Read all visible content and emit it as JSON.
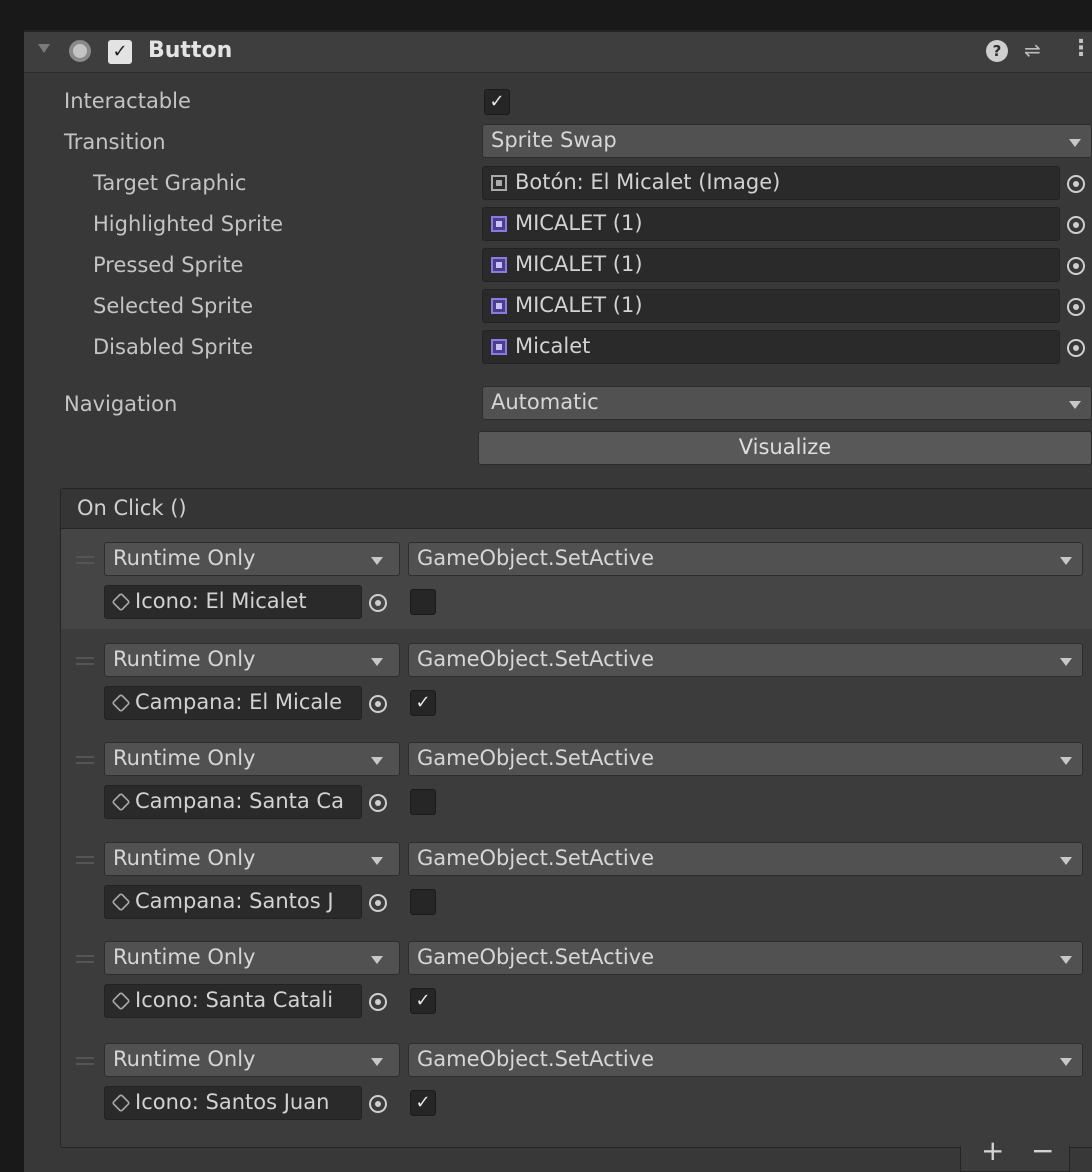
{
  "component": {
    "title": "Button",
    "enabled_check": "✓",
    "fold_icon": "foldout-arrow-icon",
    "help_icon": "help-icon",
    "help_glyph": "?",
    "preset_icon": "preset-icon",
    "preset_glyph": "⇌",
    "more_icon": "kebab-menu-icon",
    "more_glyph": "⋮"
  },
  "properties": {
    "interactable": {
      "label": "Interactable",
      "checked": true,
      "check": "✓"
    },
    "transition": {
      "label": "Transition",
      "value": "Sprite Swap"
    },
    "target_graphic": {
      "label": "Target Graphic",
      "value": "Botón: El Micalet (Image)",
      "icon": "image-icon"
    },
    "highlighted_sprite": {
      "label": "Highlighted Sprite",
      "value": "MICALET (1)",
      "icon": "sprite-icon"
    },
    "pressed_sprite": {
      "label": "Pressed Sprite",
      "value": "MICALET (1)",
      "icon": "sprite-icon"
    },
    "selected_sprite": {
      "label": "Selected Sprite",
      "value": "MICALET (1)",
      "icon": "sprite-icon"
    },
    "disabled_sprite": {
      "label": "Disabled Sprite",
      "value": "Micalet",
      "icon": "sprite-icon"
    },
    "navigation": {
      "label": "Navigation",
      "value": "Automatic"
    },
    "visualize": {
      "label": "Visualize"
    }
  },
  "on_click": {
    "title": "On Click ()",
    "add": "+",
    "remove": "−",
    "events": [
      {
        "mode": "Runtime Only",
        "function": "GameObject.SetActive",
        "object": "Icono: El Micalet",
        "checked": false,
        "check": ""
      },
      {
        "mode": "Runtime Only",
        "function": "GameObject.SetActive",
        "object": "Campana: El Micale",
        "checked": true,
        "check": "✓"
      },
      {
        "mode": "Runtime Only",
        "function": "GameObject.SetActive",
        "object": "Campana: Santa Ca",
        "checked": false,
        "check": ""
      },
      {
        "mode": "Runtime Only",
        "function": "GameObject.SetActive",
        "object": "Campana: Santos J",
        "checked": false,
        "check": ""
      },
      {
        "mode": "Runtime Only",
        "function": "GameObject.SetActive",
        "object": "Icono: Santa Catali",
        "checked": true,
        "check": "✓"
      },
      {
        "mode": "Runtime Only",
        "function": "GameObject.SetActive",
        "object": "Icono: Santos Juan",
        "checked": true,
        "check": "✓"
      }
    ]
  }
}
